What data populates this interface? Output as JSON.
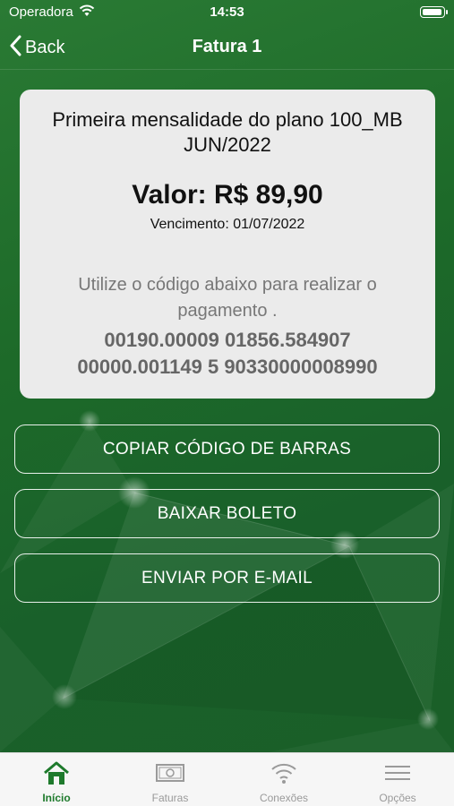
{
  "status_bar": {
    "carrier": "Operadora",
    "time": "14:53"
  },
  "nav": {
    "back_label": "Back",
    "title": "Fatura 1"
  },
  "invoice": {
    "plan_name": "Primeira mensalidade do plano 100_MB",
    "plan_month": "JUN/2022",
    "amount": "Valor: R$ 89,90",
    "due": "Vencimento: 01/07/2022",
    "instruction": "Utilize o código abaixo para realizar o pagamento .",
    "barcode_line1": "00190.00009 01856.584907",
    "barcode_line2": "00000.001149 5 90330000008990"
  },
  "actions": {
    "copy_label": "COPIAR CÓDIGO DE BARRAS",
    "download_label": "BAIXAR BOLETO",
    "email_label": "ENVIAR POR E-MAIL"
  },
  "tabs": [
    {
      "label": "Início",
      "icon": "home-icon",
      "active": true
    },
    {
      "label": "Faturas",
      "icon": "banknote-icon",
      "active": false
    },
    {
      "label": "Conexões",
      "icon": "wifi-icon",
      "active": false
    },
    {
      "label": "Opções",
      "icon": "menu-icon",
      "active": false
    }
  ],
  "colors": {
    "brand_green": "#1e7a2c",
    "card_bg": "#ebebeb"
  }
}
